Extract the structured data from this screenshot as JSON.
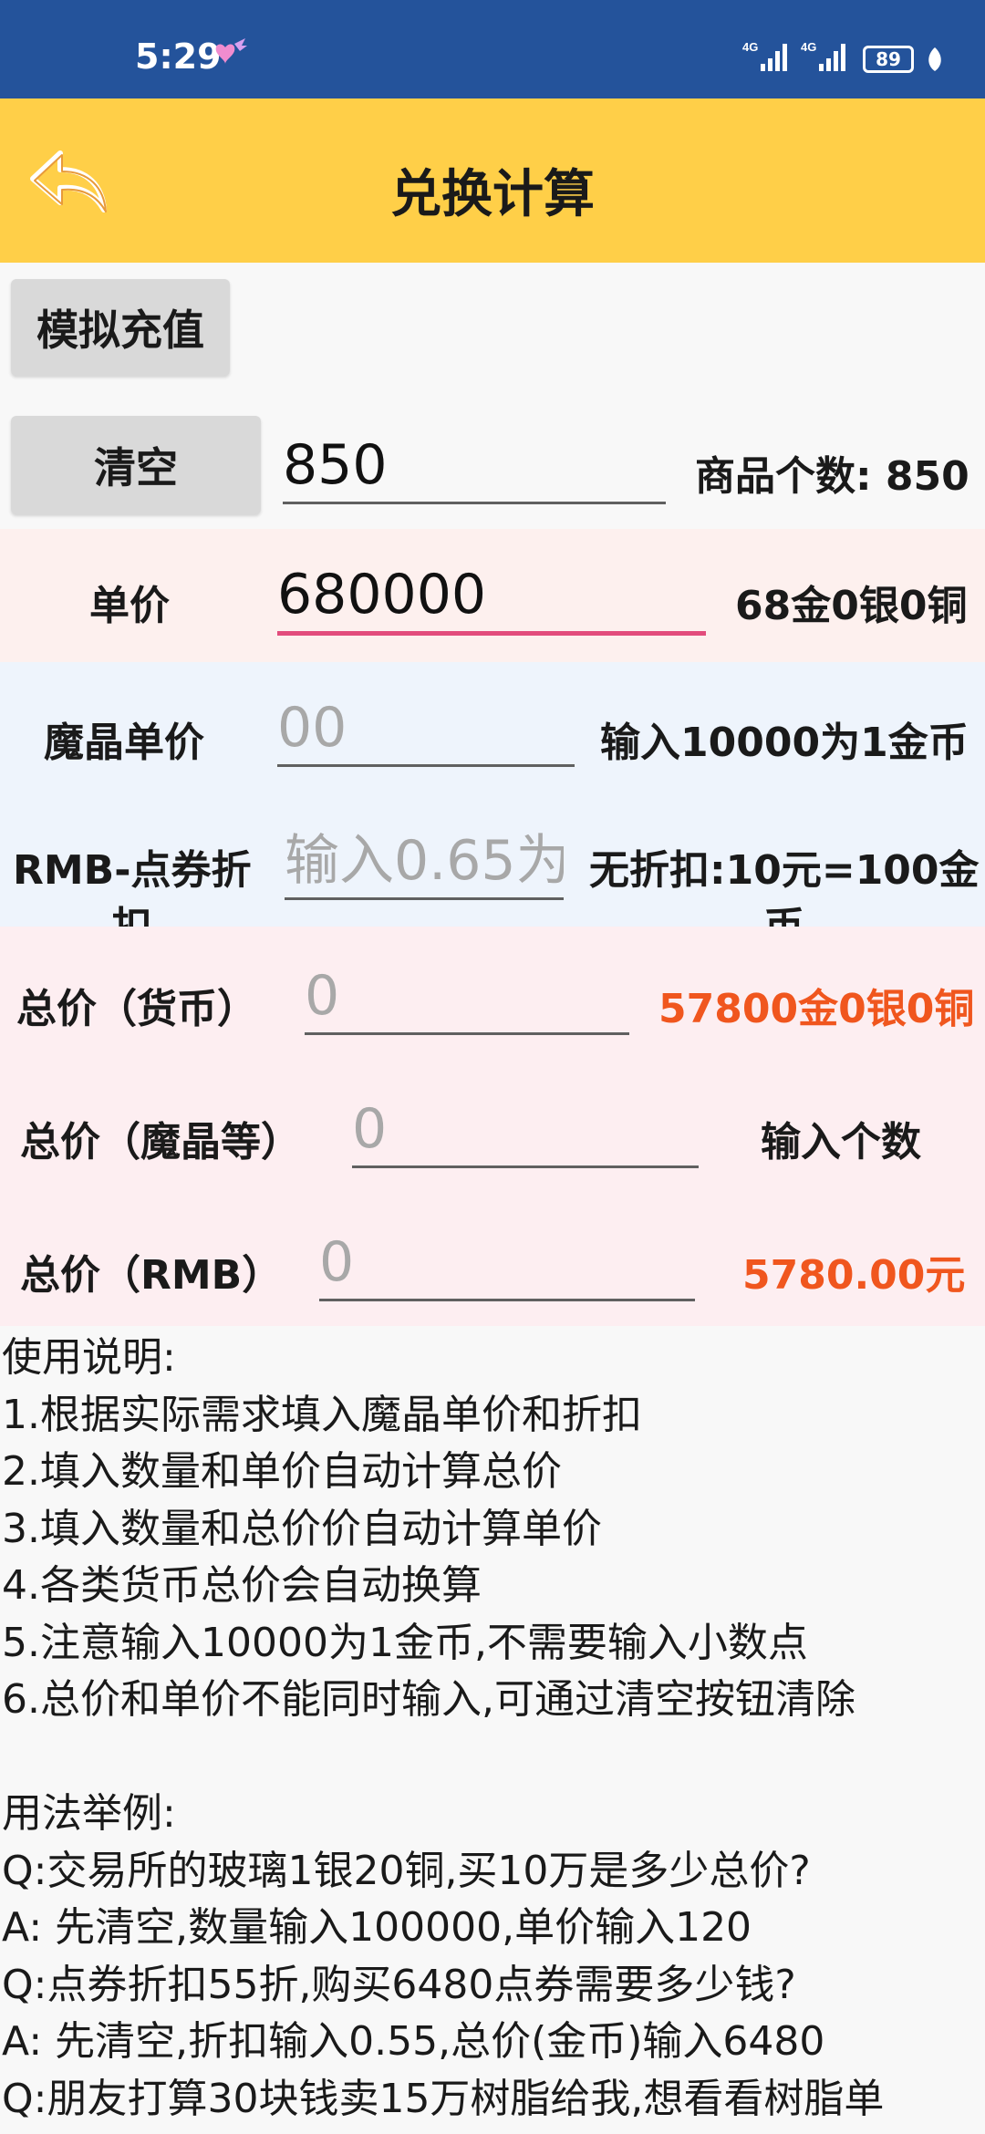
{
  "status": {
    "time": "5:29",
    "signal1": "4G",
    "signal2": "4G",
    "battery": "89"
  },
  "header": {
    "title": "兑换计算"
  },
  "buttons": {
    "simulate": "模拟充值",
    "clear": "清空"
  },
  "quantity": {
    "value": "850",
    "result": "商品个数: 850"
  },
  "unit_price": {
    "label": "单价",
    "value": "680000",
    "result": "68金0银0铜"
  },
  "crystal_price": {
    "label": "魔晶单价",
    "placeholder": "00",
    "result": "输入10000为1金币"
  },
  "discount": {
    "label_line1": "RMB-点券折",
    "label_line2": "扣",
    "placeholder": "输入0.65为",
    "result_line1": "无折扣:10元=100金",
    "result_line2": "币"
  },
  "total_currency": {
    "label": "总价（货币）",
    "placeholder": "0",
    "result": "57800金0银0铜"
  },
  "total_crystal": {
    "label": "总价（魔晶等）",
    "placeholder": "0",
    "result": "输入个数"
  },
  "total_rmb": {
    "label": "总价（RMB）",
    "placeholder": "0",
    "result": "5780.00元"
  },
  "instructions": {
    "lines": [
      "使用说明:",
      "1.根据实际需求填入魔晶单价和折扣",
      "2.填入数量和单价自动计算总价",
      "3.填入数量和总价价自动计算单价",
      "4.各类货币总价会自动换算",
      "5.注意输入10000为1金币,不需要输入小数点",
      "6.总价和单价不能同时输入,可通过清空按钮清除",
      "",
      "用法举例:",
      "Q:交易所的玻璃1银20铜,买10万是多少总价?",
      "A:  先清空,数量输入100000,单价输入120",
      "Q:点券折扣55折,购买6480点券需要多少钱?",
      "A:  先清空,折扣输入0.55,总价(金币)输入6480",
      "Q:朋友打算30块钱卖15万树脂给我,想看看树脂单"
    ]
  },
  "colors": {
    "statusbar": "#24539b",
    "appbar": "#ffcf48",
    "unit_bg": "#fdf0ee",
    "crystal_bg": "#eef4fc",
    "total_bg": "#fdeef1",
    "orange": "#f0561e",
    "focus": "#e24c7c"
  }
}
